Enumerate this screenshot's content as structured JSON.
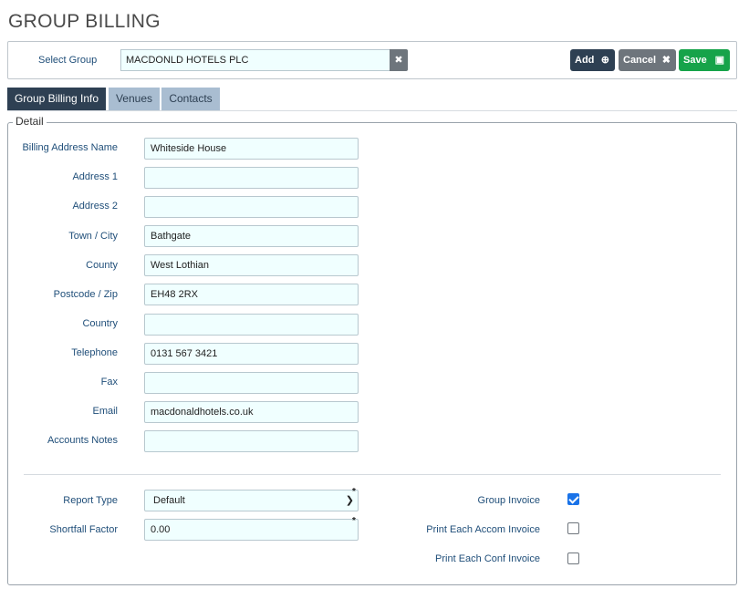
{
  "page": {
    "title": "GROUP BILLING"
  },
  "group_select": {
    "label": "Select Group",
    "value": "MACDONLD HOTELS PLC",
    "clear_icon": "close-icon"
  },
  "toolbar": {
    "add_label": "Add",
    "add_icon": "plus-circle-icon",
    "cancel_label": "Cancel",
    "cancel_icon": "close-icon",
    "save_label": "Save",
    "save_icon": "floppy-disk-icon"
  },
  "tabs": [
    {
      "label": "Group Billing Info",
      "active": true
    },
    {
      "label": "Venues",
      "active": false
    },
    {
      "label": "Contacts",
      "active": false
    }
  ],
  "detail": {
    "legend": "Detail",
    "fields": [
      {
        "label": "Billing Address Name",
        "value": "Whiteside House"
      },
      {
        "label": "Address 1",
        "value": ""
      },
      {
        "label": "Address 2",
        "value": ""
      },
      {
        "label": "Town / City",
        "value": "Bathgate"
      },
      {
        "label": "County",
        "value": "West Lothian"
      },
      {
        "label": "Postcode / Zip",
        "value": "EH48 2RX"
      },
      {
        "label": "Country",
        "value": ""
      },
      {
        "label": "Telephone",
        "value": "0131 567 3421"
      },
      {
        "label": "Fax",
        "value": ""
      },
      {
        "label": "Email",
        "value": "macdonaldhotels.co.uk"
      },
      {
        "label": "Accounts Notes",
        "value": ""
      }
    ]
  },
  "options": {
    "report_type": {
      "label": "Report Type",
      "value": "Default",
      "required_mark": "*"
    },
    "shortfall_factor": {
      "label": "Shortfall Factor",
      "value": "0.00",
      "required_mark": "*"
    },
    "group_invoice": {
      "label": "Group Invoice",
      "checked": true
    },
    "print_each_accom_invoice": {
      "label": "Print Each Accom Invoice",
      "checked": false
    },
    "print_each_conf_invoice": {
      "label": "Print Each Conf Invoice",
      "checked": false
    }
  },
  "colors": {
    "primary_dark": "#2e4053",
    "secondary": "#6e757c",
    "success": "#16a34a",
    "tab_inactive": "#a9bdd1",
    "input_bg": "#f0ffff",
    "label_text": "#1f4e79",
    "checkbox_checked": "#1a73e8"
  }
}
